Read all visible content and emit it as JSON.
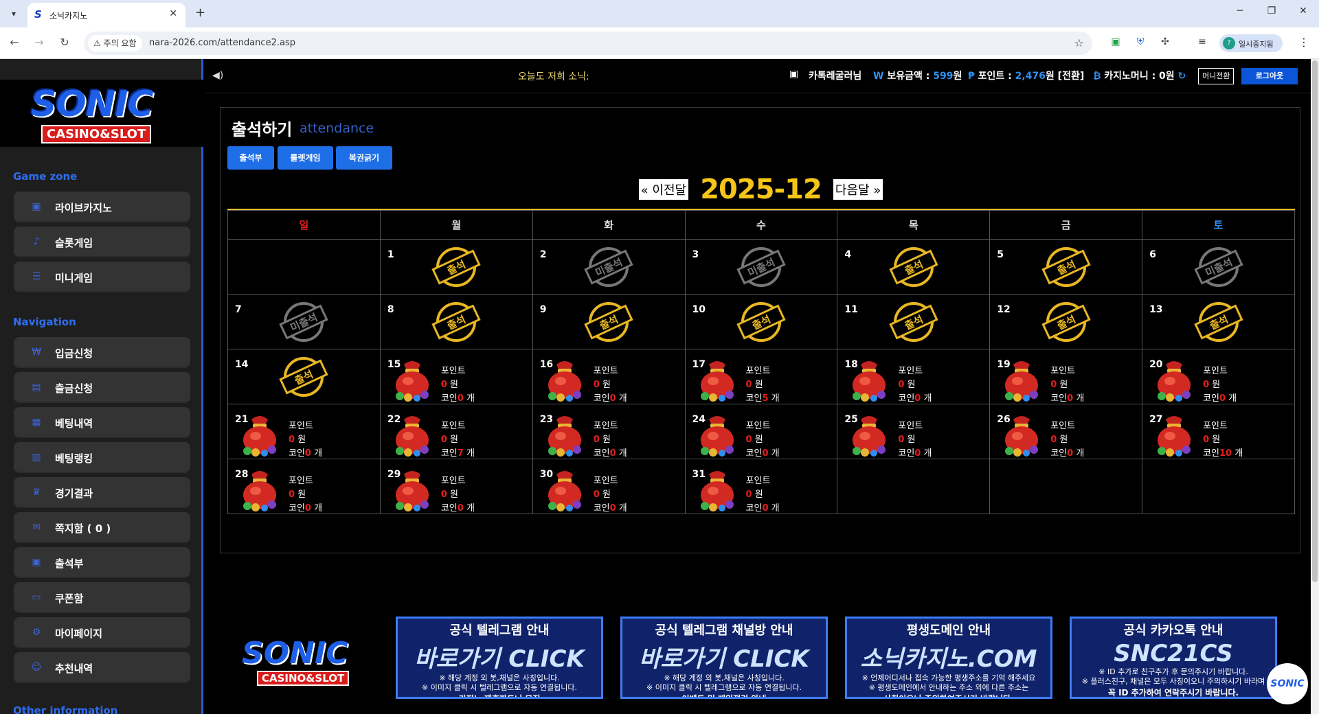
{
  "browser": {
    "tab_title": "소닉카지노",
    "url": "nara-2026.com/attendance2.asp",
    "warning": "주의 요함",
    "profile_name": "일시중지됨",
    "profile_initial": "?"
  },
  "sidebar": {
    "logo_main": "SONIC",
    "logo_sub": "CASINO&SLOT",
    "game_zone_title": "Game zone",
    "game_items": [
      {
        "label": "라이브카지노"
      },
      {
        "label": "슬롯게임"
      },
      {
        "label": "미니게임"
      }
    ],
    "nav_title": "Navigation",
    "nav_items": [
      {
        "label": "입금신청"
      },
      {
        "label": "출금신청"
      },
      {
        "label": "베팅내역"
      },
      {
        "label": "베팅랭킹"
      },
      {
        "label": "경기결과"
      },
      {
        "label": "쪽지함 ( 0 )"
      },
      {
        "label": "출석부"
      },
      {
        "label": "쿠폰함"
      },
      {
        "label": "마이페이지"
      },
      {
        "label": "추천내역"
      }
    ],
    "other_title": "Other information"
  },
  "topbar": {
    "marquee": "오늘도 저희 소닉:",
    "username": "카톡레굴러님",
    "balance_label": "보유금액 :",
    "balance_value": "599",
    "balance_unit": "원",
    "point_label": "포인트 :",
    "point_value": "2,476",
    "point_unit": "원 [전환]",
    "casino_label": "카지노머니 : 0원",
    "money_convert": "머니전환",
    "logout": "로그아웃"
  },
  "page": {
    "title": "출석하기",
    "subtitle": "attendance",
    "tabs": [
      "출석부",
      "룰렛게임",
      "복권긁기"
    ],
    "prev": "« 이전달",
    "next": "다음달 »",
    "month": "2025-12"
  },
  "calendar": {
    "weekdays": [
      "일",
      "월",
      "화",
      "수",
      "목",
      "금",
      "토"
    ],
    "weekday_colors": {
      "sun": "#e51e1e",
      "sat": "#2f8ff0",
      "other": "#dddddd"
    },
    "stamp_attended": "출석",
    "stamp_absent": "미출석",
    "point_label": "포인트",
    "won_unit": "원",
    "coin_label": "코인",
    "coin_unit": "개",
    "weeks": [
      [
        null,
        {
          "day": "1",
          "status": "attended"
        },
        {
          "day": "2",
          "status": "absent"
        },
        {
          "day": "3",
          "status": "absent"
        },
        {
          "day": "4",
          "status": "attended"
        },
        {
          "day": "5",
          "status": "attended"
        },
        {
          "day": "6",
          "status": "absent"
        }
      ],
      [
        {
          "day": "7",
          "status": "absent"
        },
        {
          "day": "8",
          "status": "attended"
        },
        {
          "day": "9",
          "status": "attended"
        },
        {
          "day": "10",
          "status": "attended"
        },
        {
          "day": "11",
          "status": "attended"
        },
        {
          "day": "12",
          "status": "attended"
        },
        {
          "day": "13",
          "status": "attended"
        }
      ],
      [
        {
          "day": "14",
          "status": "attended"
        },
        {
          "day": "15",
          "status": "reward",
          "points": "0",
          "coins": "0"
        },
        {
          "day": "16",
          "status": "reward",
          "points": "0",
          "coins": "0"
        },
        {
          "day": "17",
          "status": "reward",
          "points": "0",
          "coins": "5"
        },
        {
          "day": "18",
          "status": "reward",
          "points": "0",
          "coins": "0"
        },
        {
          "day": "19",
          "status": "reward",
          "points": "0",
          "coins": "0"
        },
        {
          "day": "20",
          "status": "reward",
          "points": "0",
          "coins": "0"
        }
      ],
      [
        {
          "day": "21",
          "status": "reward",
          "points": "0",
          "coins": "0"
        },
        {
          "day": "22",
          "status": "reward",
          "points": "0",
          "coins": "7"
        },
        {
          "day": "23",
          "status": "reward",
          "points": "0",
          "coins": "0"
        },
        {
          "day": "24",
          "status": "reward",
          "points": "0",
          "coins": "0"
        },
        {
          "day": "25",
          "status": "reward",
          "points": "0",
          "coins": "0"
        },
        {
          "day": "26",
          "status": "reward",
          "points": "0",
          "coins": "0"
        },
        {
          "day": "27",
          "status": "reward",
          "points": "0",
          "coins": "10"
        }
      ],
      [
        {
          "day": "28",
          "status": "reward",
          "points": "0",
          "coins": "0"
        },
        {
          "day": "29",
          "status": "reward",
          "points": "0",
          "coins": "0"
        },
        {
          "day": "30",
          "status": "reward",
          "points": "0",
          "coins": "0"
        },
        {
          "day": "31",
          "status": "reward",
          "points": "0",
          "coins": "0"
        },
        null,
        null,
        null
      ]
    ]
  },
  "footer": {
    "logo_main": "SONIC",
    "logo_sub": "CASINO&SLOT",
    "banners": [
      {
        "title": "공식 텔레그램 안내",
        "main": "바로가기 CLICK",
        "l1": "※ 해당 계정 외 봇,채널은 사칭입니다.",
        "l2": "※ 이미지 클릭 시 텔레그램으로 자동 연결됩니다.",
        "bottom": "카지노 제휴파트너 모집"
      },
      {
        "title": "공식 텔레그램 채널방 안내",
        "main": "바로가기 CLICK",
        "l1": "※ 해당 계정 외 봇,채널은 사칭입니다.",
        "l2": "※ 이미지 클릭 시 텔레그램으로 자동 연결됩니다.",
        "bottom": "이벤트 및 게임점검 안내"
      },
      {
        "title": "평생도메인 안내",
        "main": "소닉카지노.COM",
        "l1": "※ 언제어디서나 접속 가능한 평생주소를 기억 해주세요",
        "l2": "※ 평생도메인에서 안내하는 주소 외에 다른 주소는",
        "bottom": "사칭이오니 주의하여주시기 바랍니다."
      },
      {
        "title": "공식 카카오톡 안내",
        "main": "SNC21CS",
        "l1": "※ ID 추가로 친구추가 후 문의주시기 바랍니다.",
        "l2": "※ 플러스친구, 채널은 모두 사칭이오니 주의하시기 바라며",
        "bottom": "꼭 ID 추가하여 연락주시기 바랍니다."
      }
    ],
    "float_logo": "SONIC"
  }
}
